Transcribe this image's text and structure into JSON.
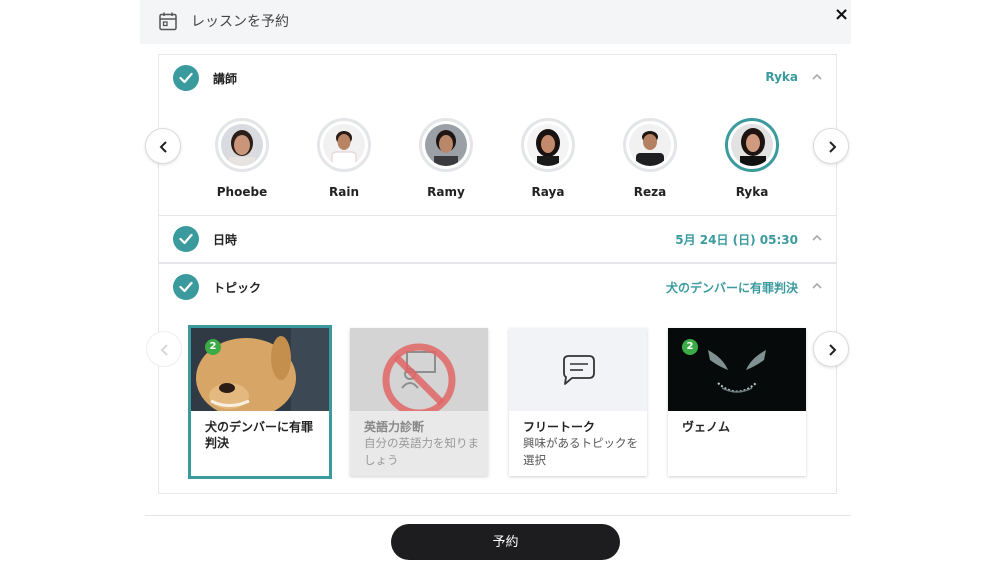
{
  "header": {
    "title": "レッスンを予約",
    "close_label": "×"
  },
  "teacher_section": {
    "label": "講師",
    "value": "Ryka"
  },
  "teachers": [
    {
      "name": "Phoebe",
      "selected": false
    },
    {
      "name": "Rain",
      "selected": false
    },
    {
      "name": "Ramy",
      "selected": false
    },
    {
      "name": "Raya",
      "selected": false
    },
    {
      "name": "Reza",
      "selected": false
    },
    {
      "name": "Ryka",
      "selected": true
    }
  ],
  "datetime_section": {
    "label": "日時",
    "value": "5月 24日 (日) 05:30"
  },
  "topic_section": {
    "label": "トピック",
    "value": "犬のデンバーに有罪判決"
  },
  "topics": [
    {
      "title": "犬のデンバーに有罪判決",
      "description": "",
      "badge": "2",
      "selected": true,
      "disabled": false
    },
    {
      "title": "英語力診断",
      "description": "自分の英語力を知りましょう",
      "badge": "",
      "selected": false,
      "disabled": true
    },
    {
      "title": "フリートーク",
      "description": "興味があるトピックを選択",
      "badge": "",
      "selected": false,
      "disabled": false
    },
    {
      "title": "ヴェノム",
      "description": "",
      "badge": "2",
      "selected": false,
      "disabled": false
    }
  ],
  "book_button": {
    "label": "予約"
  },
  "colors": {
    "accent": "#3a9a9e",
    "badge": "#3bab45",
    "button": "#1d1d1f"
  }
}
